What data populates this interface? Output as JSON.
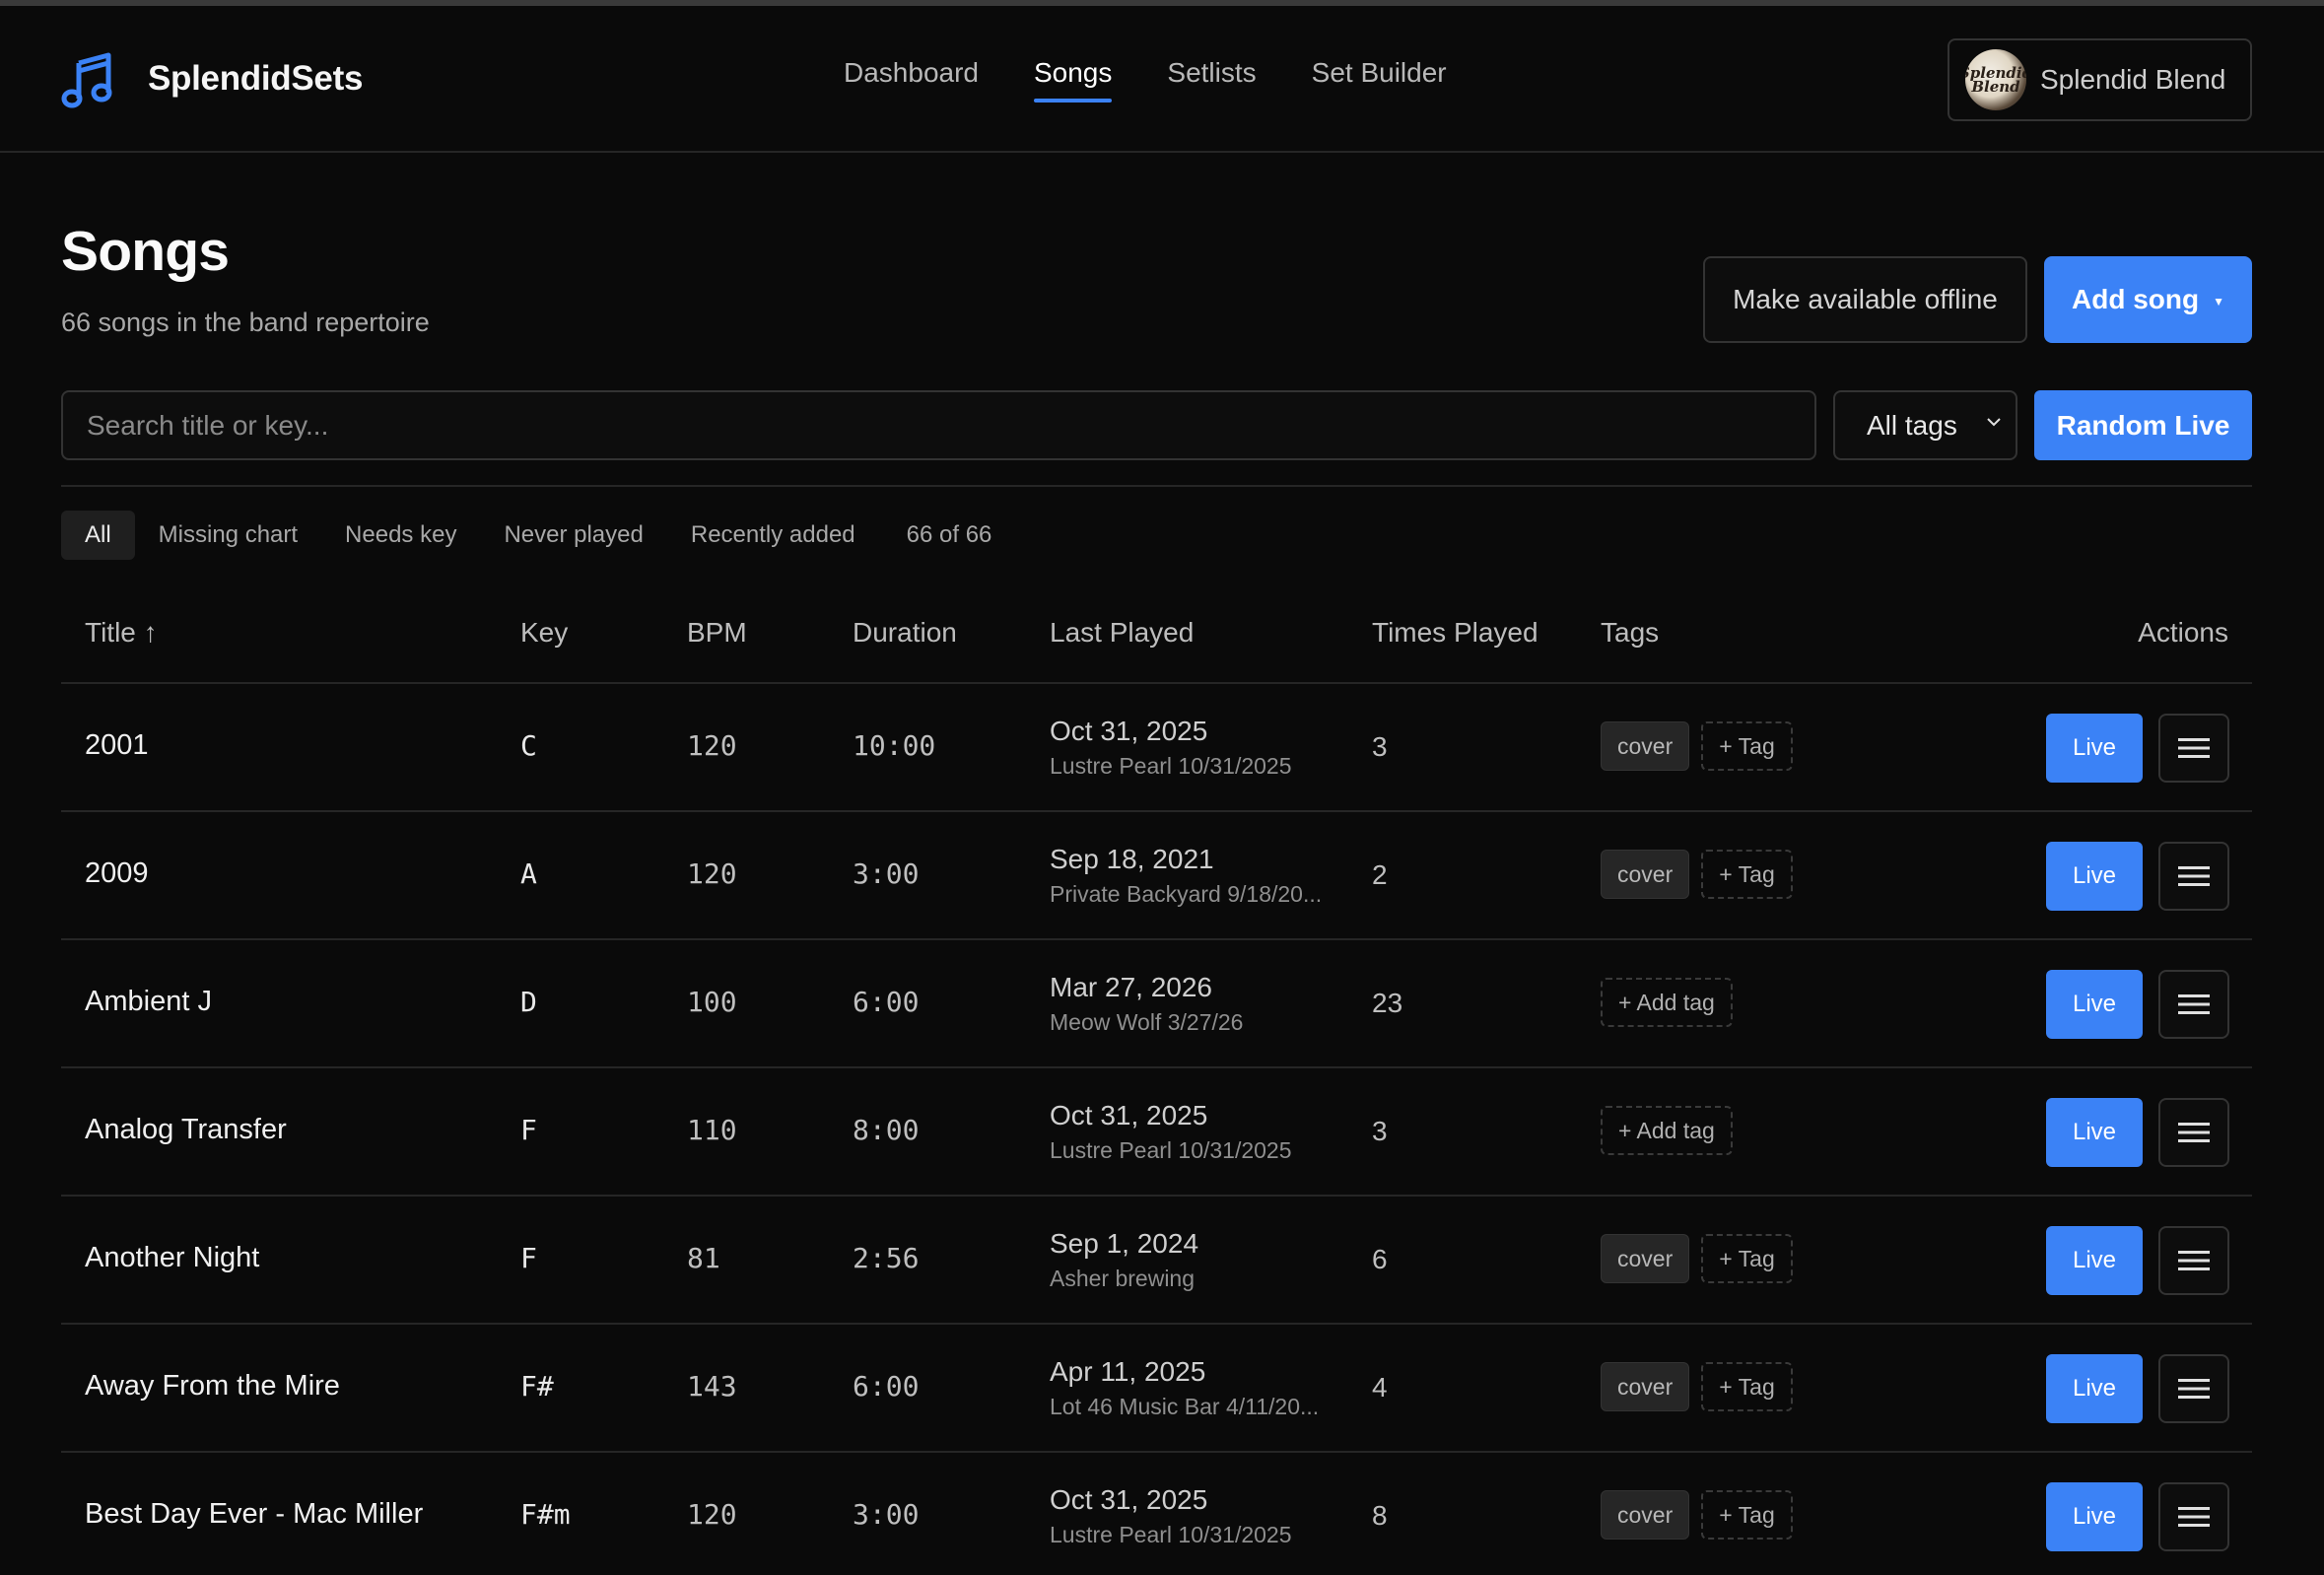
{
  "app": {
    "name": "SplendidSets",
    "brand_icon": "music-note-icon",
    "accent": "#3b82f6"
  },
  "nav": {
    "items": [
      {
        "label": "Dashboard",
        "active": false
      },
      {
        "label": "Songs",
        "active": true
      },
      {
        "label": "Setlists",
        "active": false
      },
      {
        "label": "Set Builder",
        "active": false
      }
    ]
  },
  "account": {
    "name": "Splendid Blend",
    "avatar_text": "Splendid Blend"
  },
  "page": {
    "title": "Songs",
    "subtitle": "66 songs in the band repertoire",
    "offline_button": "Make available offline",
    "add_button": "Add song"
  },
  "search": {
    "placeholder": "Search title or key...",
    "value": ""
  },
  "tag_filter": {
    "selected": "All tags"
  },
  "random_button": "Random Live",
  "filters": {
    "items": [
      {
        "label": "All",
        "active": true
      },
      {
        "label": "Missing chart",
        "active": false
      },
      {
        "label": "Needs key",
        "active": false
      },
      {
        "label": "Never played",
        "active": false
      },
      {
        "label": "Recently added",
        "active": false
      }
    ],
    "count": "66 of 66"
  },
  "table": {
    "columns": {
      "title": "Title ↑",
      "key": "Key",
      "bpm": "BPM",
      "duration": "Duration",
      "last_played": "Last Played",
      "times_played": "Times Played",
      "tags": "Tags",
      "actions": "Actions"
    },
    "live_label": "Live",
    "add_tag_label": "+ Add tag",
    "tag_label": "+ Tag",
    "rows": [
      {
        "title": "2001",
        "key": "C",
        "bpm": "120",
        "duration": "10:00",
        "date": "Oct 31, 2025",
        "venue": "Lustre Pearl 10/31/2025",
        "times": "3",
        "tags": [
          "cover"
        ]
      },
      {
        "title": "2009",
        "key": "A",
        "bpm": "120",
        "duration": "3:00",
        "date": "Sep 18, 2021",
        "venue": "Private Backyard 9/18/20...",
        "times": "2",
        "tags": [
          "cover"
        ]
      },
      {
        "title": "Ambient J",
        "key": "D",
        "bpm": "100",
        "duration": "6:00",
        "date": "Mar 27, 2026",
        "venue": "Meow Wolf 3/27/26",
        "times": "23",
        "tags": []
      },
      {
        "title": "Analog Transfer",
        "key": "F",
        "bpm": "110",
        "duration": "8:00",
        "date": "Oct 31, 2025",
        "venue": "Lustre Pearl 10/31/2025",
        "times": "3",
        "tags": []
      },
      {
        "title": "Another Night",
        "key": "F",
        "bpm": "81",
        "duration": "2:56",
        "date": "Sep 1, 2024",
        "venue": "Asher brewing",
        "times": "6",
        "tags": [
          "cover"
        ]
      },
      {
        "title": "Away From the Mire",
        "key": "F#",
        "bpm": "143",
        "duration": "6:00",
        "date": "Apr 11, 2025",
        "venue": "Lot 46 Music Bar 4/11/20...",
        "times": "4",
        "tags": [
          "cover"
        ]
      },
      {
        "title": "Best Day Ever - Mac Miller",
        "key": "F#m",
        "bpm": "120",
        "duration": "3:00",
        "date": "Oct 31, 2025",
        "venue": "Lustre Pearl 10/31/2025",
        "times": "8",
        "tags": [
          "cover"
        ]
      }
    ]
  }
}
